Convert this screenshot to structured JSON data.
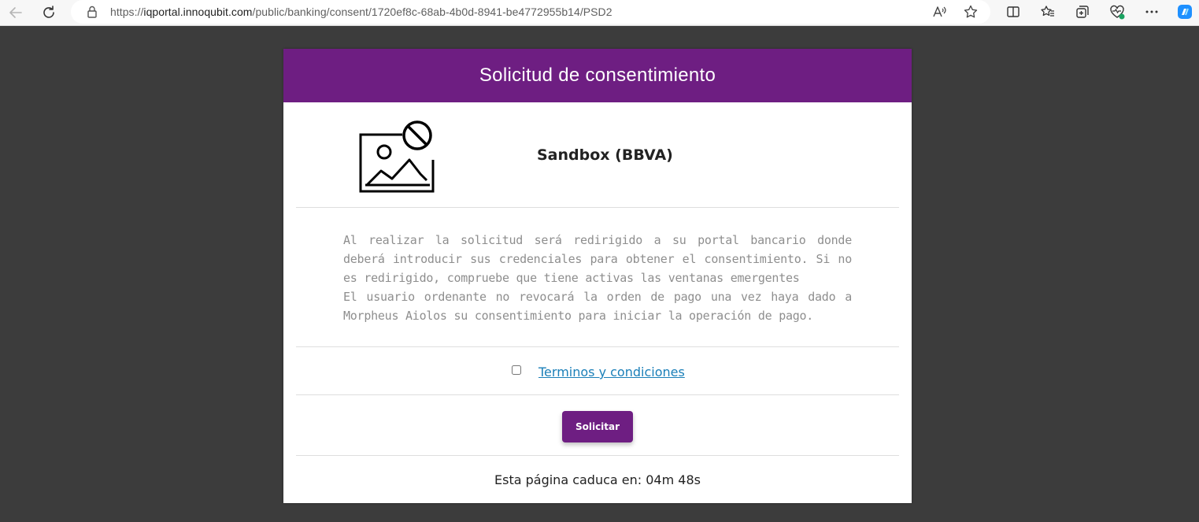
{
  "browser": {
    "url_scheme": "https://",
    "url_host": "iqportal.innoqubit.com",
    "url_path": "/public/banking/consent/1720ef8c-68ab-4b0d-8941-be4772955b14/PSD2",
    "icons": [
      "back-arrow-icon",
      "reload-icon",
      "lock-icon",
      "read-aloud-icon",
      "favorite-star-icon",
      "split-screen-icon",
      "favorites-icon",
      "collections-icon",
      "health-icon",
      "more-icon",
      "copilot-icon"
    ]
  },
  "consent": {
    "title": "Solicitud de consentimiento",
    "bank_name": "Sandbox (BBVA)",
    "info_paragraph_1": "Al realizar la solicitud será redirigido a su portal bancario donde deberá introducir sus credenciales para obtener el consentimiento. Si no es redirigido, compruebe que tiene activas las ventanas emergentes",
    "info_paragraph_2": "El usuario ordenante no revocará la orden de pago una vez haya dado a Morpheus Aiolos su consentimiento para iniciar la operación de pago.",
    "terms_label": "Terminos y condiciones",
    "terms_checked": false,
    "submit_label": "Solicitar",
    "expiry_text": "Esta página caduca en: 04m 48s"
  },
  "colors": {
    "brand": "#6e1e82",
    "background": "#3c3c3c",
    "link": "#1a7fb8",
    "muted_text": "#8e8e8e"
  }
}
